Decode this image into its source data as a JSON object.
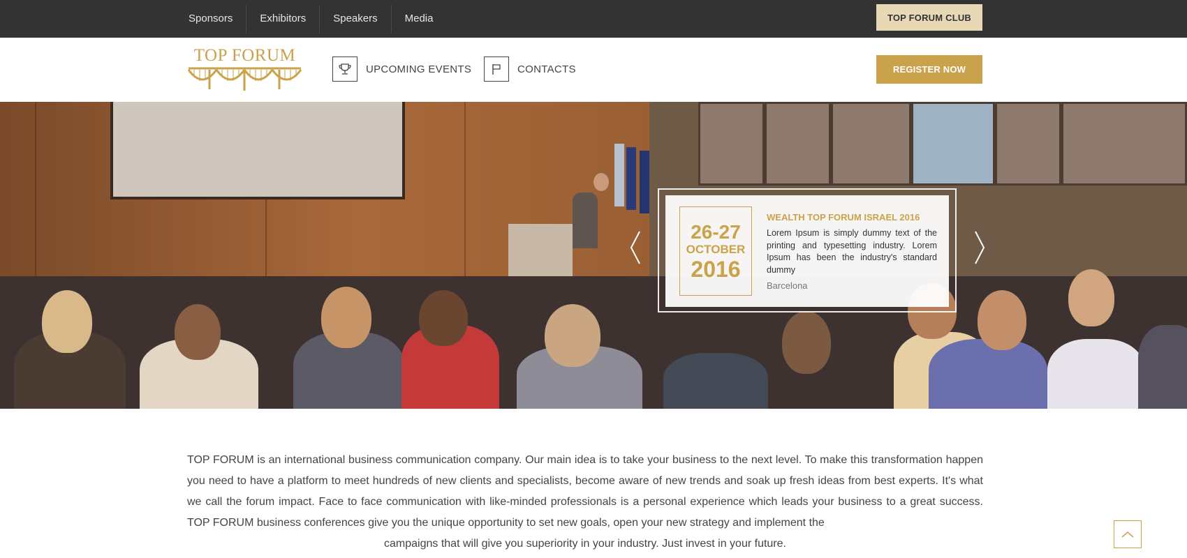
{
  "topbar": {
    "links": [
      "Sponsors",
      "Exhibitors",
      "Speakers",
      "Media"
    ],
    "club_button": "TOP FORUM CLUB"
  },
  "header": {
    "logo_text": "TOP FORUM",
    "nav": [
      {
        "label": "UPCOMING EVENTS",
        "icon": "trophy-icon"
      },
      {
        "label": "CONTACTS",
        "icon": "flag-icon"
      }
    ],
    "register_button": "REGISTER NOW"
  },
  "hero": {
    "event": {
      "days": "26-27",
      "month": "OCTOBER",
      "year": "2016",
      "title": "WEALTH TOP FORUM ISRAEL 2016",
      "description": "Lorem Ipsum is simply dummy text of the printing and typesetting industry. Lorem Ipsum has been the industry's standard dummy",
      "city": "Barcelona"
    }
  },
  "intro": {
    "text": "TOP FORUM is an international business communication company. Our main idea is to take your business to the next level. To make this transformation happen you need to have a platform to meet hundreds of new clients and specialists, become aware of new trends and soak up fresh ideas from best experts. It's what we call the forum impact. Face to face communication with like-minded professionals is a personal experience which leads your business to a great success. TOP FORUM business conferences give you the unique opportunity to set new goals, open your new strategy and implement the",
    "last_line": "campaigns that will give you superiority in your industry. Just invest in your future."
  },
  "colors": {
    "accent": "#c9a24b",
    "topbar": "#333333",
    "club_button": "#e9d8b6"
  }
}
